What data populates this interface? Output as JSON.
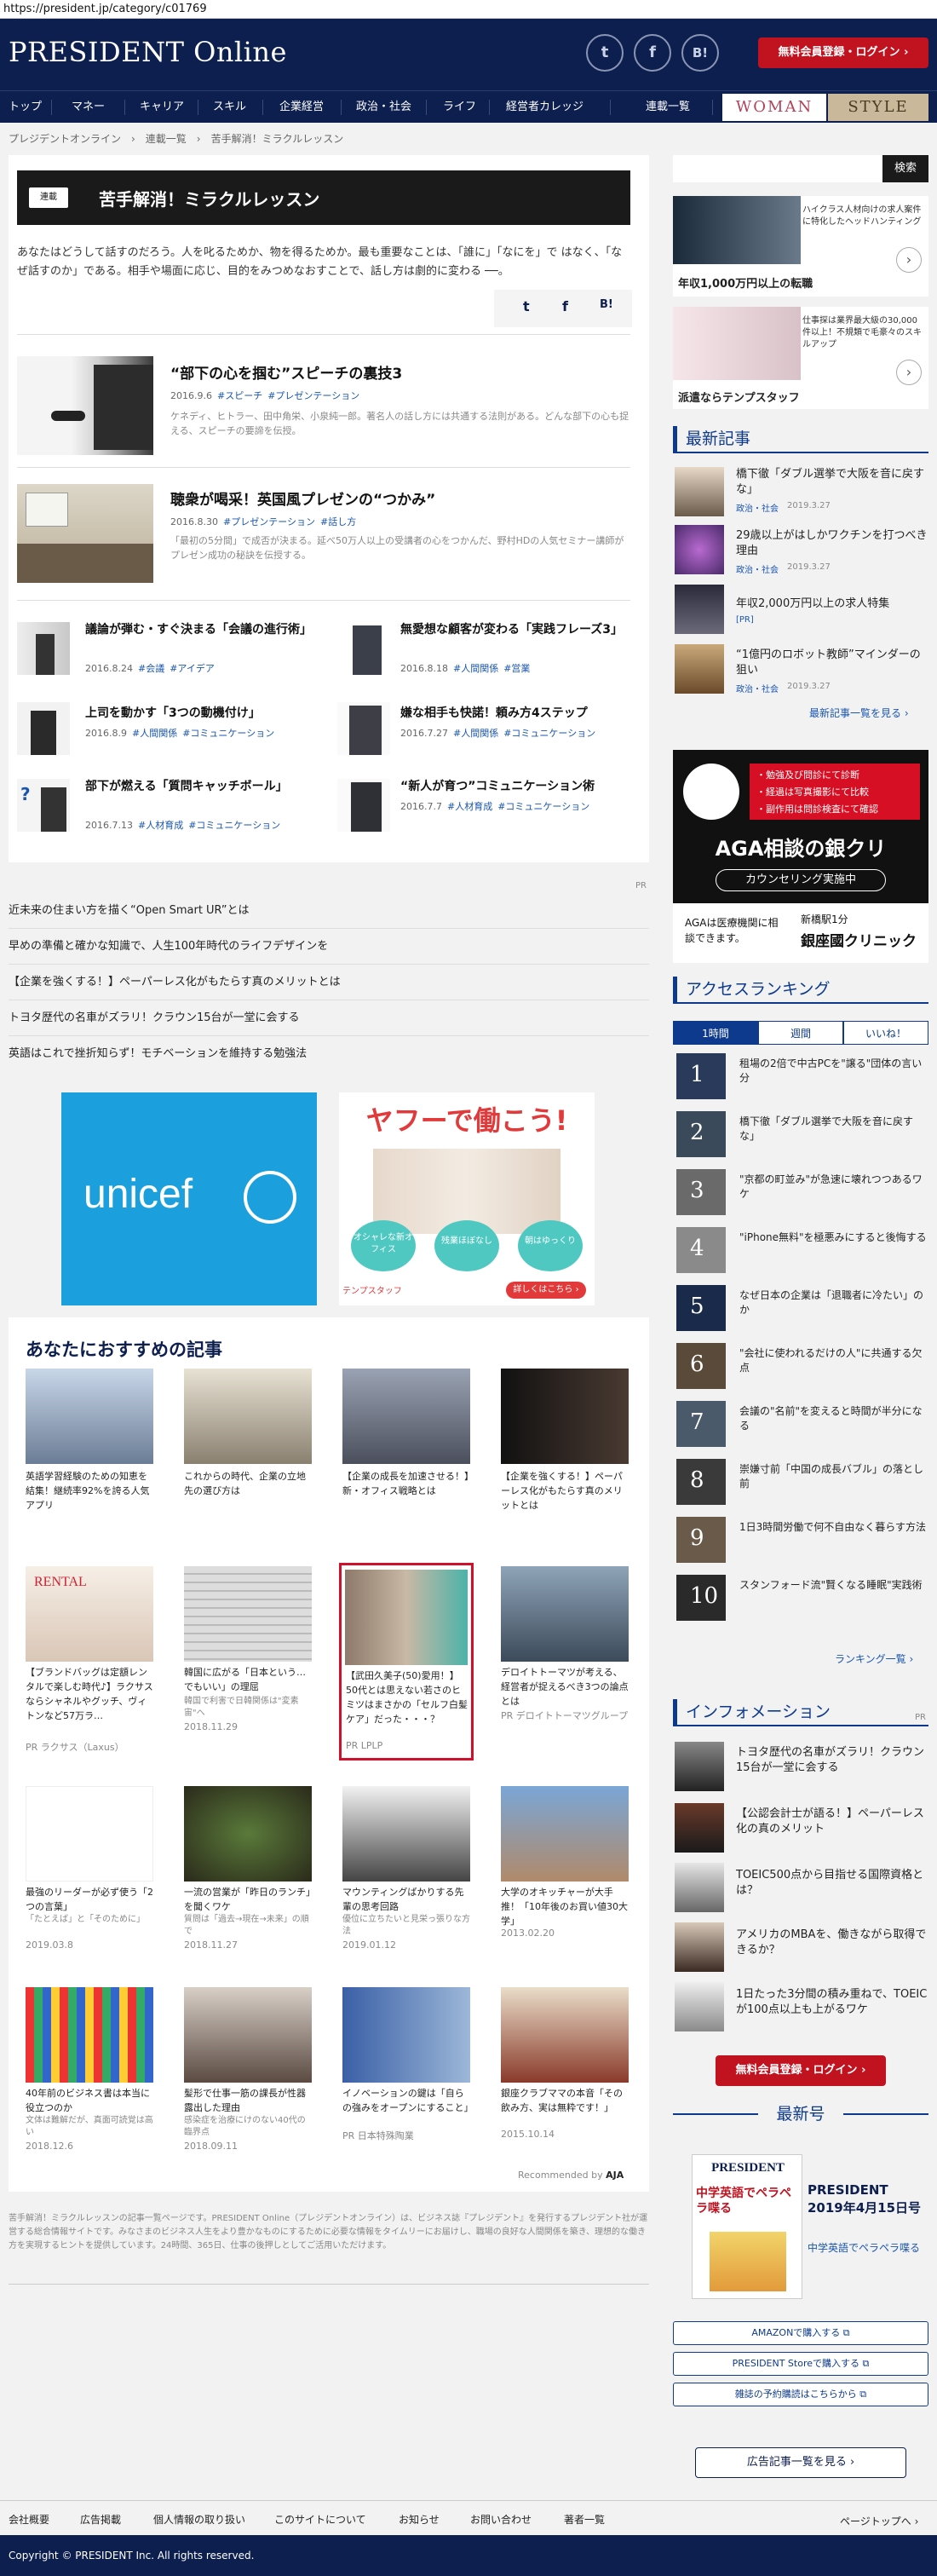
{
  "browser": {
    "url": "https://president.jp/category/c01769"
  },
  "header": {
    "logo": "PRESIDENT Online",
    "social": [
      "t",
      "f",
      "B!"
    ],
    "register_login": "無料会員登録・ログイン ›"
  },
  "nav": {
    "items": [
      "トップ",
      "マネー",
      "キャリア",
      "スキル",
      "企業経営",
      "政治・社会",
      "ライフ",
      "経営者カレッジ"
    ],
    "serial": "連載一覧",
    "woman": "WOMAN",
    "style": "STYLE"
  },
  "breadcrumb": "プレジデントオンライン　›　連載一覧　›　苦手解消！ミラクルレッスン",
  "series": {
    "tag": "連載",
    "title": "苦手解消！ミラクルレッスン",
    "intro": "あなたはどうして話すのだろう。人を叱るためか、物を得るためか。最も重要なことは、「誰に」「なにを」で はなく、「なぜ話すのか」である。相手や場面に応じ、目的をみつめなおすことで、話し方は劇的に変わる ──。"
  },
  "featured": [
    {
      "title": "“部下の心を掴む”スピーチの裏技3",
      "date": "2016.9.6",
      "tags": [
        "#スピーチ",
        "#プレゼンテーション"
      ],
      "desc": "ケネディ、ヒトラー、田中角栄、小泉純一郎。著名人の話し方には共通する法則がある。どんな部下の心も捉える、スピーチの要諦を伝授。"
    },
    {
      "title": "聴衆が喝采！英国風プレゼンの“つかみ”",
      "date": "2016.8.30",
      "tags": [
        "#プレゼンテーション",
        "#話し方"
      ],
      "desc": "「最初の5分間」で成否が決まる。延べ50万人以上の受講者の心をつかんだ、野村HDの人気セミナー講師がプレゼン成功の秘訣を伝授する。"
    }
  ],
  "articles": [
    {
      "title": "議論が弾む・すぐ決まる「会議の進行術」",
      "date": "2016.8.24",
      "tags": [
        "#会議",
        "#アイデア"
      ]
    },
    {
      "title": "無愛想な顧客が変わる「実践フレーズ3」",
      "date": "2016.8.18",
      "tags": [
        "#人間関係",
        "#営業"
      ]
    },
    {
      "title": "上司を動かす「3つの動機付け」",
      "date": "2016.8.9",
      "tags": [
        "#人間関係",
        "#コミュニケーション"
      ]
    },
    {
      "title": "嫌な相手も快諾！頼み方4ステップ",
      "date": "2016.7.27",
      "tags": [
        "#人間関係",
        "#コミュニケーション"
      ]
    },
    {
      "title": "部下が燃える「質問キャッチボール」",
      "date": "2016.7.13",
      "tags": [
        "#人材育成",
        "#コミュニケーション"
      ]
    },
    {
      "title": "“新人が育つ”コミュニケーション術",
      "date": "2016.7.7",
      "tags": [
        "#人材育成",
        "#コミュニケーション"
      ]
    }
  ],
  "pr_label": "PR",
  "pr_links": [
    "近未来の住まい方を描く“Open Smart UR”とは",
    "早めの準備と確かな知識で、人生100年時代のライフデザインを",
    "【企業を強くする！】ペーパーレス化がもたらす真のメリットとは",
    "トヨタ歴代の名車がズラリ！クラウン15台が一堂に会する",
    "英語はこれで挫折知らず！モチベーションを維持する勉強法"
  ],
  "ads": {
    "unicef": "unicef",
    "yahoo_title": "ヤフーで働こう!",
    "yahoo_bubbles": [
      "オシャレな新オフィス",
      "残業ほぼなし",
      "朝はゆっくり"
    ],
    "yahoo_cta": "詳しくはこちら ›",
    "yahoo_brand": "テンプスタッフ"
  },
  "recommend": {
    "heading": "あなたにおすすめの記事",
    "items": [
      {
        "title": "英語学習経験のための知恵を結集！継続率92%を誇る人気アプリ",
        "sub": "",
        "foot": ""
      },
      {
        "title": "これからの時代、企業の立地先の選び方は",
        "sub": "",
        "foot": ""
      },
      {
        "title": "【企業の成長を加速させる！】新・オフィス戦略とは",
        "sub": "",
        "foot": ""
      },
      {
        "title": "【企業を強くする！】ペーパーレス化がもたらす真のメリットとは",
        "sub": "",
        "foot": ""
      },
      {
        "title": "【ブランドバッグは定額レンタルで楽しむ時代♪】ラクサスならシャネルやグッチ、ヴィトンなど57万ラ…",
        "sub": "",
        "foot": "PR ラクサス（Laxus）"
      },
      {
        "title": "韓国に広がる「日本という…でもいい」の理屈",
        "sub": "韓国で利害で日韓関係は\"変素宙\"へ",
        "foot": "2018.11.29"
      },
      {
        "title": "【武田久美子(50)愛用！】50代とは思えない若さのヒミツはまさかの「セルフ白髪ケア」だった・・・？",
        "sub": "",
        "foot": "PR LPLP"
      },
      {
        "title": "デロイトトーマツが考える、経営者が捉えるべき3つの論点とは",
        "sub": "",
        "foot": "PR デロイトトーマツグループ"
      },
      {
        "title": "最強のリーダーが必ず使う「2つの言葉」",
        "sub": "「たとえば」と「そのために」",
        "foot": "2019.03.8"
      },
      {
        "title": "一流の営業が「昨日のランチ」を聞くワケ",
        "sub": "質問は「過去→現在→未来」の順で",
        "foot": "2018.11.27"
      },
      {
        "title": "マウンティングばかりする先輩の思考回路",
        "sub": "優位に立ちたいと見栄っ張りな方法",
        "foot": "2019.01.12"
      },
      {
        "title": "大学のオキッチャーが大手推！「10年後のお買い値30大学」",
        "sub": "",
        "foot": "2013.02.20"
      },
      {
        "title": "40年前のビジネス書は本当に役立つのか",
        "sub": "文体は難解だが、真面可読覚は高い",
        "foot": "2018.12.6"
      },
      {
        "title": "髪形で仕事一筋の課長が性器露出した理由",
        "sub": "感染症を治療にけのない40代の臨界点",
        "foot": "2018.09.11"
      },
      {
        "title": "イノベーションの鍵は「自らの強みをオープンにすること」",
        "sub": "",
        "foot": "PR 日本特殊陶業"
      },
      {
        "title": "銀座クラブママの本音「その飲み方、実は無粋です！」",
        "sub": "",
        "foot": "2015.10.14"
      }
    ],
    "powered": "Recommended by"
  },
  "footnote": "苦手解消！ミラクルレッスンの記事一覧ページです。PRESIDENT Online（プレジデントオンライン）は、ビジネス誌『プレジデント』を発行するプレジデント社が運営する総合情報サイトです。みなさまのビジネス人生をより豊かなものにするために必要な情報をタイムリーにお届けし、職場の良好な人間関係を築き、理想的な働き方を実現するヒントを提供しています。24時間、365日、仕事の後押しとしてご活用いただけます。",
  "sidebar": {
    "search_button": "検索",
    "ad1": {
      "caption": "年収1,000万円以上の転職",
      "text": "ハイクラス人材向けの求人案件に特化したヘッドハンティング"
    },
    "ad2": {
      "caption": "派遣ならテンプスタッフ",
      "text": "仕事探は業界最大級の30,000件以上！不規類で毛豪々のスキルアップ"
    },
    "latest_heading": "最新記事",
    "latest": [
      {
        "title": "橋下徹「ダブル選挙で大阪を音に戻すな」",
        "cat": "政治・社会",
        "date": "2019.3.27"
      },
      {
        "title": "29歳以上がはしかワクチンを打つべき理由",
        "cat": "政治・社会",
        "date": "2019.3.27"
      },
      {
        "title": "年収2,000万円以上の求人特集",
        "cat": "[PR]",
        "date": ""
      },
      {
        "title": "“1億円のロボット教師”マインダーの狙い",
        "cat": "政治・社会",
        "date": "2019.3.27"
      }
    ],
    "latest_more": "最新記事一覧を見る ›",
    "aga": {
      "bullets": [
        "・勉強及び問診にて診断",
        "・経過は写真撮影にて比較",
        "・副作用は問診検査にて確認"
      ],
      "title": "AGA相談の銀クリ",
      "sub": "カウンセリング実施中",
      "note": "AGAは医療機関に相談できます。",
      "station": "新橋駅1分",
      "clinic": "銀座國クリニック"
    },
    "ranking_heading": "アクセスランキング",
    "ranking_tabs": [
      "1時間",
      "週間",
      "いいね！"
    ],
    "ranking": [
      {
        "num": "1",
        "title": "租場の2倍で中古PCを\"譲る\"団体の言い分"
      },
      {
        "num": "2",
        "title": "橋下徹「ダブル選挙で大阪を音に戻すな」"
      },
      {
        "num": "3",
        "title": "\"京都の町並み\"が急速に壊れつつあるワケ"
      },
      {
        "num": "4",
        "title": "\"iPhone無料\"を極悪みにすると後悔する"
      },
      {
        "num": "5",
        "title": "なぜ日本の企業は「退職者に冷たい」のか"
      },
      {
        "num": "6",
        "title": "\"会社に使われるだけの人\"に共通する欠点"
      },
      {
        "num": "7",
        "title": "会議の\"名前\"を変えると時間が半分になる"
      },
      {
        "num": "8",
        "title": "崇嫌寸前「中国の成長バブル」の落とし前"
      },
      {
        "num": "9",
        "title": "1日3時間労働で何不自由なく暮らす方法"
      },
      {
        "num": "10",
        "title": "スタンフォード流\"賢くなる睡眠\"実践術"
      }
    ],
    "ranking_more": "ランキング一覧 ›",
    "info_heading": "インフォメーション",
    "info_pr": "PR",
    "info": [
      "トヨタ歴代の名車がズラリ！クラウン15台が一堂に会する",
      "【公認会計士が語る！】ペーパーレス化の真のメリット",
      "TOEIC500点から目指せる国際資格とは？",
      "アメリカのMBAを、働きながら取得できるか？",
      "1日たった3分間の積み重ねで、TOEICが100点以上も上がるワケ"
    ],
    "register2": "無料会員登録・ログイン ›",
    "newest_heading": "最新号",
    "magazine": {
      "cover_title": "PRESIDENT",
      "cover_headline": "中学英語でペラペラ喋る",
      "title": "PRESIDENT 2019年4月15日号",
      "sub": "中学英語でペラペラ喋る"
    },
    "buy": [
      "AMAZONで購入する",
      "PRESIDENT Storeで購入する",
      "雑誌の予約購読はこちらから"
    ],
    "adlist": "広告記事一覧を見る ›"
  },
  "footer": {
    "links": [
      "会社概要",
      "広告掲載",
      "個人情報の取り扱い",
      "このサイトについて",
      "お知らせ",
      "お問い合わせ",
      "著者一覧"
    ],
    "pagetop": "ページトップへ ›",
    "copyright": "Copyright © PRESIDENT Inc. All rights reserved."
  },
  "colors": {
    "navy": "#0d1f4f",
    "accent": "#0d3a8c",
    "red": "#c1121f",
    "link": "#1a56b0"
  }
}
